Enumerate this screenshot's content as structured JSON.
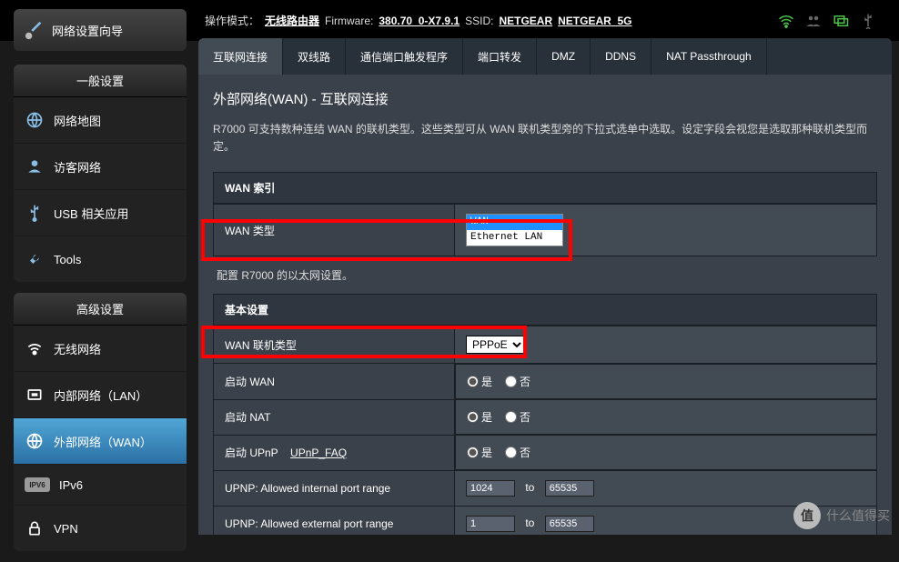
{
  "header": {
    "mode_label": "操作模式：",
    "mode_value": "无线路由器",
    "fw_label": "Firmware:",
    "fw_value": "380.70_0-X7.9.1",
    "ssid_label": "SSID:",
    "ssid1": "NETGEAR",
    "ssid2": "NETGEAR_5G"
  },
  "wizard": "网络设置向导",
  "sections": {
    "general": "一般设置",
    "advanced": "高级设置"
  },
  "menu_general": [
    {
      "label": "网络地图"
    },
    {
      "label": "访客网络"
    },
    {
      "label": "USB 相关应用"
    },
    {
      "label": "Tools"
    }
  ],
  "menu_advanced": [
    {
      "label": "无线网络"
    },
    {
      "label": "内部网络（LAN）"
    },
    {
      "label": "外部网络（WAN）"
    },
    {
      "label": "IPv6"
    },
    {
      "label": "VPN"
    }
  ],
  "tabs": [
    "互联网连接",
    "双线路",
    "通信端口触发程序",
    "端口转发",
    "DMZ",
    "DDNS",
    "NAT Passthrough"
  ],
  "page": {
    "title": "外部网络(WAN) - 互联网连接",
    "desc": "R7000 可支持数种连结 WAN 的联机类型。这些类型可从 WAN 联机类型旁的下拉式选单中选取。设定字段会视您是选取那种联机类型而定。"
  },
  "wan_index": {
    "header": "WAN 索引",
    "type_label": "WAN 类型",
    "options": [
      "WAN",
      "Ethernet LAN"
    ],
    "between": "配置 R7000 的以太网设置。"
  },
  "basic": {
    "header": "基本设置",
    "conn_type_label": "WAN 联机类型",
    "conn_type_value": "PPPoE",
    "enable_wan": "启动 WAN",
    "enable_nat": "启动 NAT",
    "enable_upnp": "启动 UPnP",
    "upnp_faq": "UPnP_FAQ",
    "yes": "是",
    "no": "否",
    "upnp_internal": "UPNP: Allowed internal port range",
    "upnp_external": "UPNP: Allowed external port range",
    "internal_from": "1024",
    "internal_to": "65535",
    "external_from": "1",
    "external_to": "65535",
    "to": "to"
  },
  "watermark": {
    "char": "值",
    "text": "什么值得买"
  }
}
